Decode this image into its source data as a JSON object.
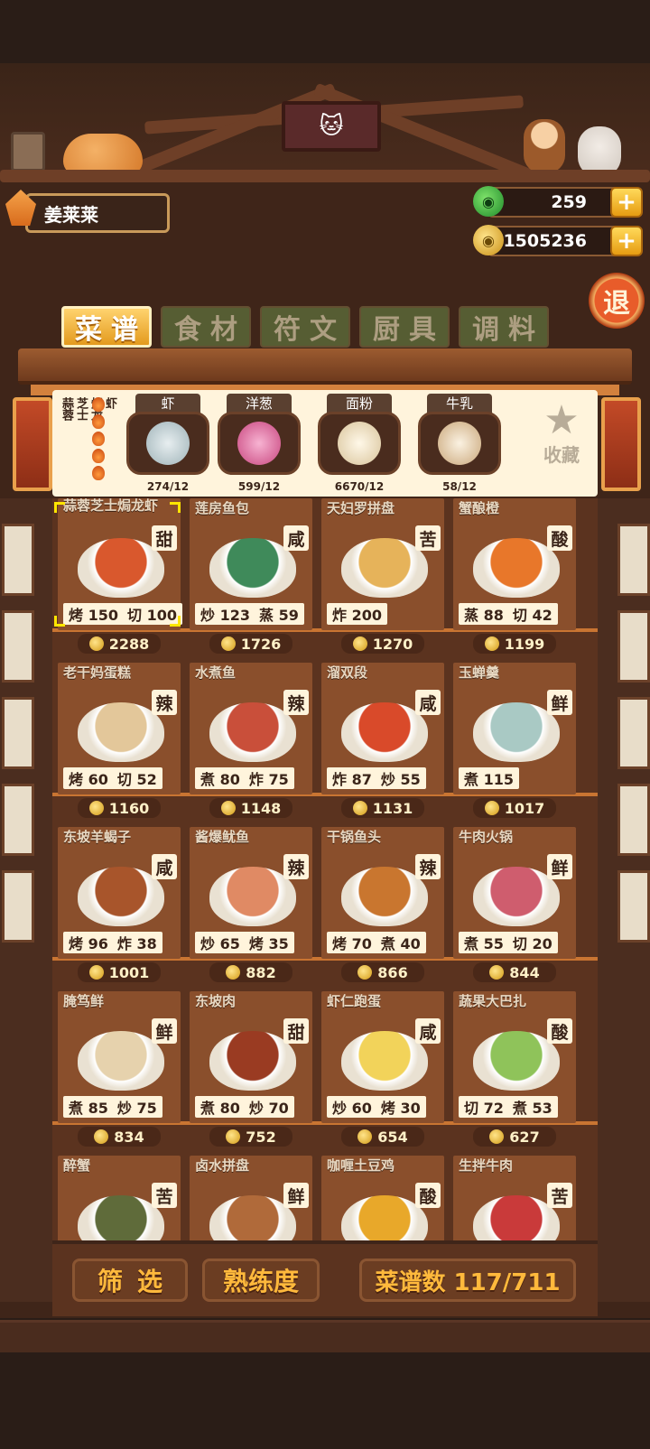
{
  "player": {
    "name": "姜莱莱"
  },
  "currencies": {
    "gems": "259",
    "gold": "1505236",
    "plus_label": "+"
  },
  "exit_label": "退",
  "tabs": [
    {
      "label": "菜谱",
      "active": true
    },
    {
      "label": "食材",
      "active": false
    },
    {
      "label": "符文",
      "active": false
    },
    {
      "label": "厨具",
      "active": false
    },
    {
      "label": "调料",
      "active": false
    }
  ],
  "selected_recipe": {
    "title_columns": [
      "蒜蓉",
      "芝士",
      "焗龙",
      "虾"
    ],
    "heat_level": 5,
    "ingredients": [
      {
        "name": "虾",
        "count": "274/12",
        "icon": "shrimp-icon",
        "color": "#d7e3e6"
      },
      {
        "name": "洋葱",
        "count": "599/12",
        "icon": "onion-icon",
        "color": "#e07aa8"
      },
      {
        "name": "面粉",
        "count": "6670/12",
        "icon": "flour-icon",
        "color": "#f1e2c0"
      },
      {
        "name": "牛乳",
        "count": "58/12",
        "icon": "milk-jar-icon",
        "color": "#e8d6b6"
      }
    ],
    "favorite_label": "收藏"
  },
  "dishes": [
    {
      "name": "蒜蓉芝士焗龙虾",
      "taste": "甜",
      "skills": [
        [
          "烤",
          "150"
        ],
        [
          "切",
          "100"
        ]
      ],
      "price": "2288",
      "color": "#d9582d"
    },
    {
      "name": "莲房鱼包",
      "taste": "咸",
      "skills": [
        [
          "炒",
          "123"
        ],
        [
          "蒸",
          "59"
        ]
      ],
      "price": "1726",
      "color": "#3f8a5a"
    },
    {
      "name": "天妇罗拼盘",
      "taste": "苦",
      "skills": [
        [
          "炸",
          "200"
        ]
      ],
      "price": "1270",
      "color": "#e6b35a"
    },
    {
      "name": "蟹酿橙",
      "taste": "酸",
      "skills": [
        [
          "蒸",
          "88"
        ],
        [
          "切",
          "42"
        ]
      ],
      "price": "1199",
      "color": "#e8772a"
    },
    {
      "name": "老干妈蛋糕",
      "taste": "辣",
      "skills": [
        [
          "烤",
          "60"
        ],
        [
          "切",
          "52"
        ]
      ],
      "price": "1160",
      "color": "#e3c79a"
    },
    {
      "name": "水煮鱼",
      "taste": "辣",
      "skills": [
        [
          "煮",
          "80"
        ],
        [
          "炸",
          "75"
        ]
      ],
      "price": "1148",
      "color": "#c94f3a"
    },
    {
      "name": "溜双段",
      "taste": "咸",
      "skills": [
        [
          "炸",
          "87"
        ],
        [
          "炒",
          "55"
        ]
      ],
      "price": "1131",
      "color": "#d94a2a"
    },
    {
      "name": "玉蝉羹",
      "taste": "鲜",
      "skills": [
        [
          "煮",
          "115"
        ]
      ],
      "price": "1017",
      "color": "#a9c9c4"
    },
    {
      "name": "东坡羊蝎子",
      "taste": "咸",
      "skills": [
        [
          "烤",
          "96"
        ],
        [
          "炸",
          "38"
        ]
      ],
      "price": "1001",
      "color": "#a8552b"
    },
    {
      "name": "酱爆鱿鱼",
      "taste": "辣",
      "skills": [
        [
          "炒",
          "65"
        ],
        [
          "烤",
          "35"
        ]
      ],
      "price": "882",
      "color": "#e08a64"
    },
    {
      "name": "干锅鱼头",
      "taste": "辣",
      "skills": [
        [
          "烤",
          "70"
        ],
        [
          "煮",
          "40"
        ]
      ],
      "price": "866",
      "color": "#c9762f"
    },
    {
      "name": "牛肉火锅",
      "taste": "鲜",
      "skills": [
        [
          "煮",
          "55"
        ],
        [
          "切",
          "20"
        ]
      ],
      "price": "844",
      "color": "#cf5d6e"
    },
    {
      "name": "腌笃鲜",
      "taste": "鲜",
      "skills": [
        [
          "煮",
          "85"
        ],
        [
          "炒",
          "75"
        ]
      ],
      "price": "834",
      "color": "#e6d2ad"
    },
    {
      "name": "东坡肉",
      "taste": "甜",
      "skills": [
        [
          "煮",
          "80"
        ],
        [
          "炒",
          "70"
        ]
      ],
      "price": "752",
      "color": "#9a3b22"
    },
    {
      "name": "虾仁跑蛋",
      "taste": "咸",
      "skills": [
        [
          "炒",
          "60"
        ],
        [
          "烤",
          "30"
        ]
      ],
      "price": "654",
      "color": "#f2d35a"
    },
    {
      "name": "蔬果大巴扎",
      "taste": "酸",
      "skills": [
        [
          "切",
          "72"
        ],
        [
          "煮",
          "53"
        ]
      ],
      "price": "627",
      "color": "#8fc35a"
    },
    {
      "name": "醉蟹",
      "taste": "苦",
      "skills": [],
      "price": "",
      "color": "#5f6b3a"
    },
    {
      "name": "卤水拼盘",
      "taste": "鲜",
      "skills": [],
      "price": "",
      "color": "#b06a3a"
    },
    {
      "name": "咖喱土豆鸡",
      "taste": "酸",
      "skills": [],
      "price": "",
      "color": "#e8a82a"
    },
    {
      "name": "生拌牛肉",
      "taste": "苦",
      "skills": [],
      "price": "",
      "color": "#c93a3a"
    }
  ],
  "bottom": {
    "filter_label": "筛选",
    "mastery_label": "熟练度",
    "recipe_count_label": "菜谱数 117/711"
  }
}
